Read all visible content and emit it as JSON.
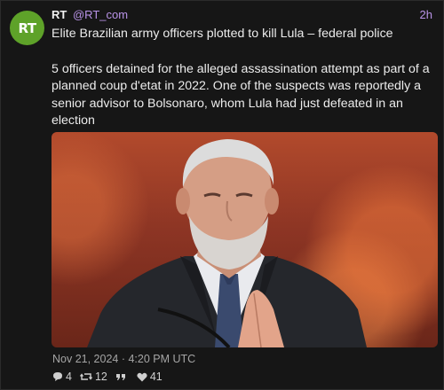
{
  "account": {
    "avatar_text": "RT",
    "name": "RT",
    "handle": "@RT_com",
    "time_ago": "2h",
    "avatar_color": "#5ea229"
  },
  "post": {
    "headline": "Elite Brazilian army officers plotted to kill Lula – federal police",
    "body": "5 officers detained for the alleged assassination attempt as part of a planned coup d'etat in 2022. One of the suspects was reportedly a senior advisor to Bolsonaro, whom Lula had just defeated in an election",
    "timestamp": "Nov 21, 2024 · 4:20 PM UTC"
  },
  "stats": {
    "replies": "4",
    "reposts": "12",
    "quotes": "",
    "likes": "41"
  },
  "icons": [
    "reply-icon",
    "repost-icon",
    "quote-icon",
    "like-icon"
  ],
  "colors": {
    "accent": "#b993e8",
    "background": "#161616"
  }
}
